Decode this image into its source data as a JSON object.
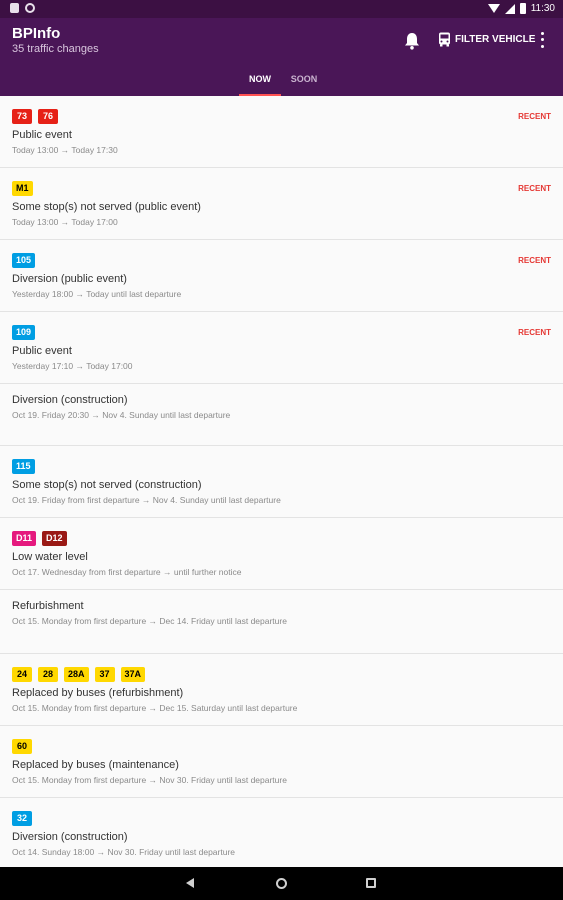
{
  "status_bar": {
    "time": "11:30"
  },
  "app_bar": {
    "title": "BPInfo",
    "subtitle": "35 traffic changes",
    "filter_label": "FILTER VEHICLE",
    "color": "#4a1657"
  },
  "tabs": [
    {
      "label": "NOW",
      "selected": true
    },
    {
      "label": "SOON",
      "selected": false
    }
  ],
  "items": [
    {
      "badges": [
        {
          "label": "73",
          "bg": "#e62117",
          "fg": "#ffffff"
        },
        {
          "label": "76",
          "bg": "#e62117",
          "fg": "#ffffff"
        }
      ],
      "title": "Public event",
      "time": "Today 13:00 → Today 17:30",
      "recent": "RECENT"
    },
    {
      "badges": [
        {
          "label": "M1",
          "bg": "#ffd800",
          "fg": "#000000"
        }
      ],
      "title": "Some stop(s) not served (public event)",
      "time": "Today 13:00 → Today 17:00",
      "recent": "RECENT"
    },
    {
      "badges": [
        {
          "label": "105",
          "bg": "#009ee3",
          "fg": "#ffffff"
        }
      ],
      "title": "Diversion (public event)",
      "time": "Yesterday 18:00 → Today until last departure",
      "recent": "RECENT"
    },
    {
      "badges": [
        {
          "label": "109",
          "bg": "#009ee3",
          "fg": "#ffffff"
        }
      ],
      "title": "Public event",
      "time": "Yesterday 17:10 → Today 17:00",
      "recent": "RECENT"
    },
    {
      "badges": [],
      "title": "Diversion (construction)",
      "time": "Oct 19. Friday 20:30 → Nov 4. Sunday until last departure",
      "recent": ""
    },
    {
      "badges": [
        {
          "label": "115",
          "bg": "#009ee3",
          "fg": "#ffffff"
        }
      ],
      "title": "Some stop(s) not served (construction)",
      "time": "Oct 19. Friday from first departure → Nov 4. Sunday until last departure",
      "recent": ""
    },
    {
      "badges": [
        {
          "label": "D11",
          "bg": "#e5197e",
          "fg": "#ffffff"
        },
        {
          "label": "D12",
          "bg": "#9a1915",
          "fg": "#ffffff"
        }
      ],
      "title": "Low water level",
      "time": "Oct 17. Wednesday from first departure →  until further notice",
      "recent": ""
    },
    {
      "badges": [],
      "title": "Refurbishment",
      "time": "Oct 15. Monday from first departure → Dec 14. Friday until last departure",
      "recent": ""
    },
    {
      "badges": [
        {
          "label": "24",
          "bg": "#ffd800",
          "fg": "#000000"
        },
        {
          "label": "28",
          "bg": "#ffd800",
          "fg": "#000000"
        },
        {
          "label": "28A",
          "bg": "#ffd800",
          "fg": "#000000"
        },
        {
          "label": "37",
          "bg": "#ffd800",
          "fg": "#000000"
        },
        {
          "label": "37A",
          "bg": "#ffd800",
          "fg": "#000000"
        }
      ],
      "title": "Replaced by buses (refurbishment)",
      "time": "Oct 15. Monday from first departure → Dec 15. Saturday until last departure",
      "recent": ""
    },
    {
      "badges": [
        {
          "label": "60",
          "bg": "#ffd800",
          "fg": "#000000"
        }
      ],
      "title": "Replaced by buses (maintenance)",
      "time": "Oct 15. Monday from first departure → Nov 30. Friday until last departure",
      "recent": ""
    },
    {
      "badges": [
        {
          "label": "32",
          "bg": "#009ee3",
          "fg": "#ffffff"
        }
      ],
      "title": "Diversion (construction)",
      "time": "Oct 14. Sunday 18:00 → Nov 30. Friday until last departure",
      "recent": ""
    }
  ]
}
